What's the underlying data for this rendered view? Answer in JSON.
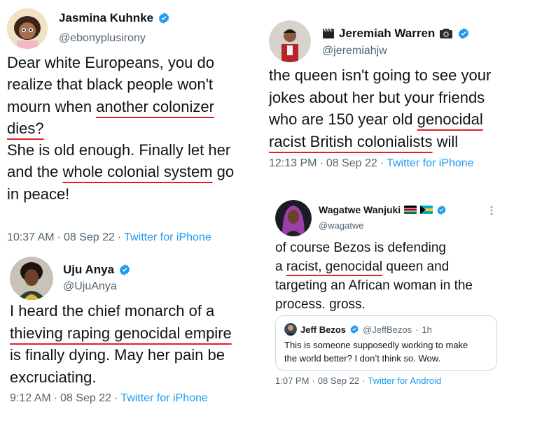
{
  "tweets": [
    {
      "name": "Jasmina Kuhnke",
      "handle": "@ebonyplusirony",
      "lines": [
        [
          {
            "t": "Dear white Europeans, you do"
          }
        ],
        [
          {
            "t": "realize that black people won't"
          }
        ],
        [
          {
            "t": "mourn when "
          },
          {
            "t": "another colonizer",
            "u": true
          }
        ],
        [
          {
            "t": "dies?",
            "u": true
          }
        ],
        [
          {
            "t": " "
          }
        ],
        [
          {
            "t": "She is old enough. Finally let her"
          }
        ],
        [
          {
            "t": "and the "
          },
          {
            "t": "whole colonial system",
            "u": true
          },
          {
            "t": " go"
          }
        ],
        [
          {
            "t": "in peace!"
          }
        ]
      ],
      "time": "10:37 AM",
      "date": "08 Sep 22",
      "source": "Twitter for iPhone"
    },
    {
      "name": "Uju Anya",
      "handle": "@UjuAnya",
      "lines": [
        [
          {
            "t": "I heard the chief monarch of a"
          }
        ],
        [
          {
            "t": "thieving raping genocidal empire",
            "u": true
          }
        ],
        [
          {
            "t": "is finally dying. May her pain be"
          }
        ],
        [
          {
            "t": "excruciating."
          }
        ]
      ],
      "time": "9:12 AM",
      "date": "08 Sep 22",
      "source": "Twitter for iPhone"
    },
    {
      "name": "Jeremiah Warren",
      "name_prefix_icon": "clapperboard-icon",
      "name_suffix_icon": "camera-icon",
      "handle": "@jeremiahjw",
      "lines": [
        [
          {
            "t": "the queen isn't going to see your"
          }
        ],
        [
          {
            "t": "jokes about her but your friends"
          }
        ],
        [
          {
            "t": "who are 150 year old "
          },
          {
            "t": "genocidal",
            "u": true
          }
        ],
        [
          {
            "t": "racist British colonialists",
            "u": true
          },
          {
            "t": " will"
          }
        ]
      ],
      "time": "12:13 PM",
      "date": "08 Sep 22",
      "source": "Twitter for iPhone"
    },
    {
      "name": "Wagatwe Wanjuki",
      "flags": [
        "kenya-flag-icon",
        "bahamas-flag-icon"
      ],
      "handle": "@wagatwe",
      "lines": [
        [
          {
            "t": "of course Bezos is defending"
          }
        ],
        [
          {
            "t": "a "
          },
          {
            "t": "racist, genocidal",
            "u": true
          },
          {
            "t": " queen and"
          }
        ],
        [
          {
            "t": "targeting an African woman in the"
          }
        ],
        [
          {
            "t": "process. gross."
          }
        ]
      ],
      "quote": {
        "name": "Jeff Bezos",
        "handle": "@JeffBezos",
        "age": "1h",
        "lines": [
          "This is someone supposedly working to make",
          "the world better? I don’t think so. Wow."
        ]
      },
      "time": "1:07 PM",
      "date": "08 Sep 22",
      "source": "Twitter for Android"
    }
  ],
  "separator": "·",
  "colors": {
    "text": "#0f1419",
    "secondary": "#536471",
    "link": "#1d9bf0",
    "verified": "#1d9bf0",
    "underline": "#e0202a"
  }
}
